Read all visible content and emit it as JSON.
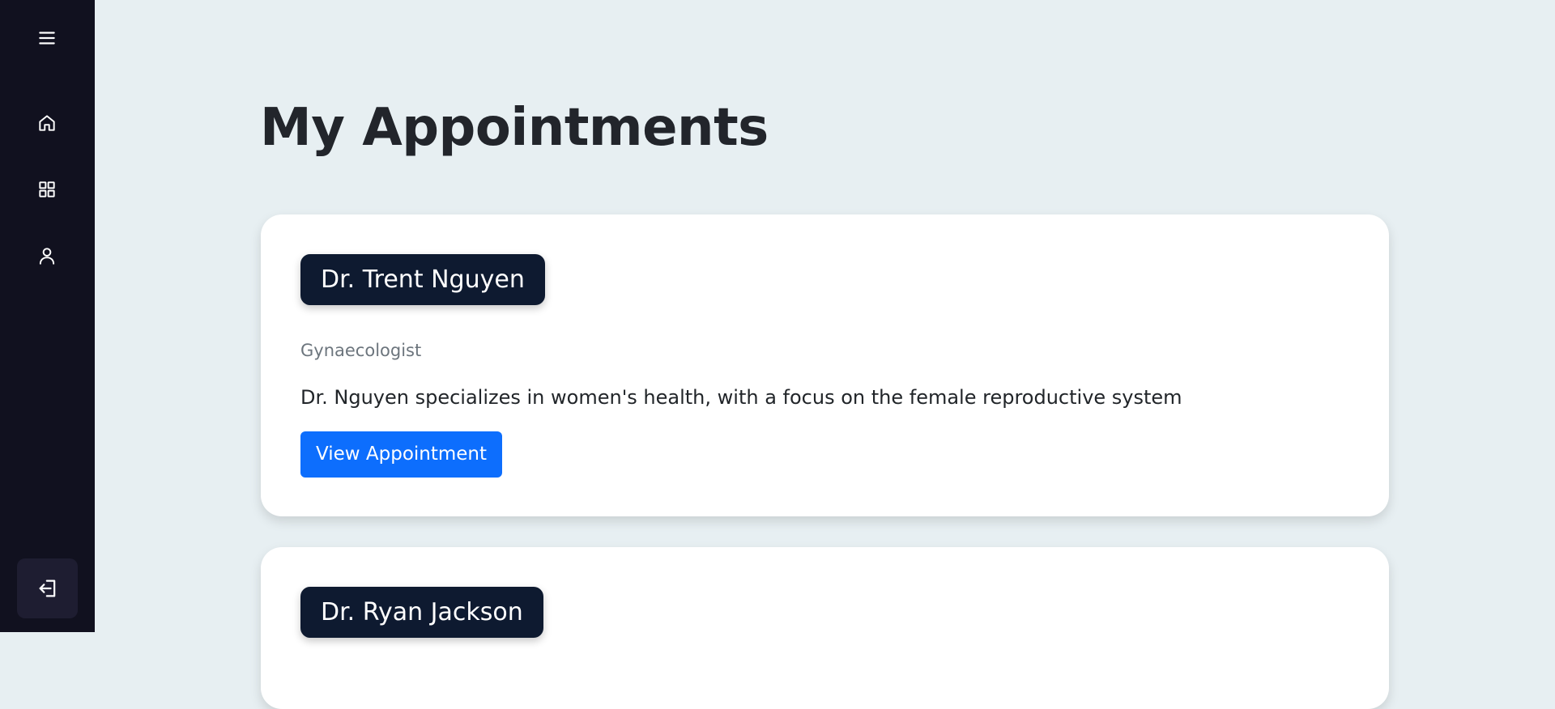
{
  "sidebar": {
    "icons": [
      "menu-icon",
      "home-icon",
      "grid-icon",
      "user-icon",
      "logout-icon"
    ]
  },
  "page_title": "My Appointments",
  "appointments": [
    {
      "doctor": "Dr. Trent Nguyen",
      "specialty": "Gynaecologist",
      "description": "Dr. Nguyen specializes in women's health, with a focus on the female reproductive system",
      "button_label": "View Appointment"
    },
    {
      "doctor": "Dr. Ryan Jackson"
    }
  ],
  "colors": {
    "background": "#e7eff2",
    "sidebar": "#11111f",
    "name_badge": "#0e1a30",
    "primary_button": "#0d6efd"
  }
}
